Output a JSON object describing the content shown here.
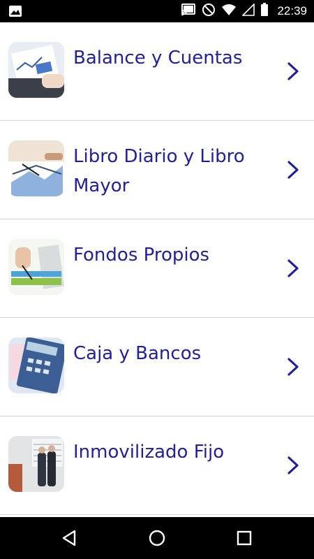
{
  "status_bar": {
    "time": "22:39",
    "icons": [
      "image-icon",
      "cast-icon",
      "do-not-disturb-icon",
      "wifi-icon",
      "cellular-signal-icon",
      "battery-icon"
    ]
  },
  "menu": {
    "items": [
      {
        "label": "Balance y Cuentas",
        "icon": "chevron-right-icon"
      },
      {
        "label": "Libro Diario y Libro Mayor",
        "icon": "chevron-right-icon"
      },
      {
        "label": "Fondos Propios",
        "icon": "chevron-right-icon"
      },
      {
        "label": "Caja y Bancos",
        "icon": "chevron-right-icon"
      },
      {
        "label": "Inmovilizado Fijo",
        "icon": "chevron-right-icon"
      }
    ]
  },
  "nav_bar": {
    "buttons": [
      "back-icon",
      "home-icon",
      "recent-apps-icon"
    ]
  },
  "colors": {
    "accent_text": "#1f1fa0",
    "divider": "#d6d6d6",
    "bar_bg": "#000000"
  }
}
